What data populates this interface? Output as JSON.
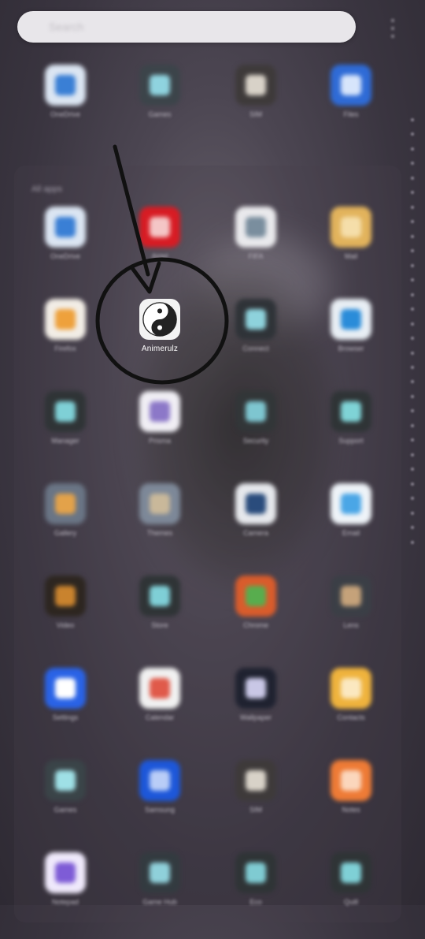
{
  "search": {
    "placeholder": "Search"
  },
  "section": {
    "label": "All apps"
  },
  "suggested_apps": [
    {
      "icon": "cloud-icon",
      "label": "OneDrive",
      "bg": "#dbe5f2",
      "glyph": "#3a7fd5"
    },
    {
      "icon": "gamepad-icon",
      "label": "Games",
      "bg": "#3c444a",
      "glyph": "#8fd3df"
    },
    {
      "icon": "sim-icon",
      "label": "SIM",
      "bg": "#3e3a3a",
      "glyph": "#d8d2c8"
    },
    {
      "icon": "folder-icon",
      "label": "Files",
      "bg": "#2f6bd6",
      "glyph": "#d7e5fb"
    }
  ],
  "apps": [
    {
      "icon": "cloud-icon",
      "label": "OneDrive",
      "bg": "#dbe5f2",
      "glyph": "#3a7fd5"
    },
    {
      "icon": "airtel-icon",
      "label": "Airtel",
      "bg": "#d71c24",
      "glyph": "#f4c6c6"
    },
    {
      "icon": "soccer-icon",
      "label": "FIFA",
      "bg": "#e9e9ec",
      "glyph": "#7a8e9e"
    },
    {
      "icon": "inbox-icon",
      "label": "Mail",
      "bg": "#e2b35c",
      "glyph": "#f5deaa"
    },
    {
      "icon": "fire-icon",
      "label": "Firefox",
      "bg": "#f2ede6",
      "glyph": "#eea13c"
    },
    {
      "icon": "yin-yang-icon",
      "label": "Animerulz",
      "bg": "#f3f3f3",
      "glyph": "#222222",
      "focused": true
    },
    {
      "icon": "link-icon",
      "label": "Connect",
      "bg": "#2f3338",
      "glyph": "#8ed2dc"
    },
    {
      "icon": "globe-icon",
      "label": "Browser",
      "bg": "#e8eef4",
      "glyph": "#2a8cd9"
    },
    {
      "icon": "gear-icon",
      "label": "Manager",
      "bg": "#2f3436",
      "glyph": "#7fd0d6"
    },
    {
      "icon": "triangle-icon",
      "label": "Prisma",
      "bg": "#f0eef4",
      "glyph": "#8c78c8"
    },
    {
      "icon": "spiral-icon",
      "label": "Security",
      "bg": "#323638",
      "glyph": "#7ec6d0"
    },
    {
      "icon": "headset-icon",
      "label": "Support",
      "bg": "#2f3436",
      "glyph": "#7fd3d6"
    },
    {
      "icon": "photo-icon",
      "label": "Gallery",
      "bg": "#6a7585",
      "glyph": "#e3a24a"
    },
    {
      "icon": "city-icon",
      "label": "Themes",
      "bg": "#7d8898",
      "glyph": "#c9b89a"
    },
    {
      "icon": "camera-icon",
      "label": "Camera",
      "bg": "#e6e8ec",
      "glyph": "#2a4c7c"
    },
    {
      "icon": "mail-icon",
      "label": "Email",
      "bg": "#eef3f8",
      "glyph": "#4aa6e6"
    },
    {
      "icon": "film-icon",
      "label": "Video",
      "bg": "#2d2620",
      "glyph": "#c9832e"
    },
    {
      "icon": "bag-icon",
      "label": "Store",
      "bg": "#2f3436",
      "glyph": "#7fcfd6"
    },
    {
      "icon": "chrome-icon",
      "label": "Chrome",
      "bg": "#d95c2c",
      "glyph": "#58ad4e"
    },
    {
      "icon": "lens-icon",
      "label": "Lens",
      "bg": "#3b3f46",
      "glyph": "#c5a27a"
    },
    {
      "icon": "settings-icon",
      "label": "Settings",
      "bg": "#2a63e6",
      "glyph": "#ffffff"
    },
    {
      "icon": "calendar-icon",
      "label": "Calendar",
      "bg": "#f1f1f1",
      "glyph": "#e05a4a"
    },
    {
      "icon": "moon-icon",
      "label": "Wallpaper",
      "bg": "#1f2230",
      "glyph": "#c9c7e6"
    },
    {
      "icon": "contacts-icon",
      "label": "Contacts",
      "bg": "#efb33d",
      "glyph": "#fbe8c0"
    },
    {
      "icon": "gamepad-icon",
      "label": "Games",
      "bg": "#3a4448",
      "glyph": "#9fe0e6"
    },
    {
      "icon": "samsung-icon",
      "label": "Samsung",
      "bg": "#1d57d9",
      "glyph": "#b9cdf7"
    },
    {
      "icon": "sim-icon",
      "label": "SIM",
      "bg": "#3e3a3a",
      "glyph": "#d8d2c8"
    },
    {
      "icon": "notes-icon",
      "label": "Notes",
      "bg": "#ee7b36",
      "glyph": "#fbd6bc"
    },
    {
      "icon": "pen-icon",
      "label": "Notepad",
      "bg": "#efe9fb",
      "glyph": "#7e5cd6"
    },
    {
      "icon": "gamepad-icon",
      "label": "Game Hub",
      "bg": "#333b40",
      "glyph": "#8fd0da"
    },
    {
      "icon": "leaf-icon",
      "label": "Eco",
      "bg": "#2f3436",
      "glyph": "#7fcbd2"
    },
    {
      "icon": "feather-icon",
      "label": "Quill",
      "bg": "#2f3436",
      "glyph": "#7fd0d6"
    }
  ],
  "annotation": {
    "circle_color": "#111111",
    "arrow_color": "#111111"
  }
}
